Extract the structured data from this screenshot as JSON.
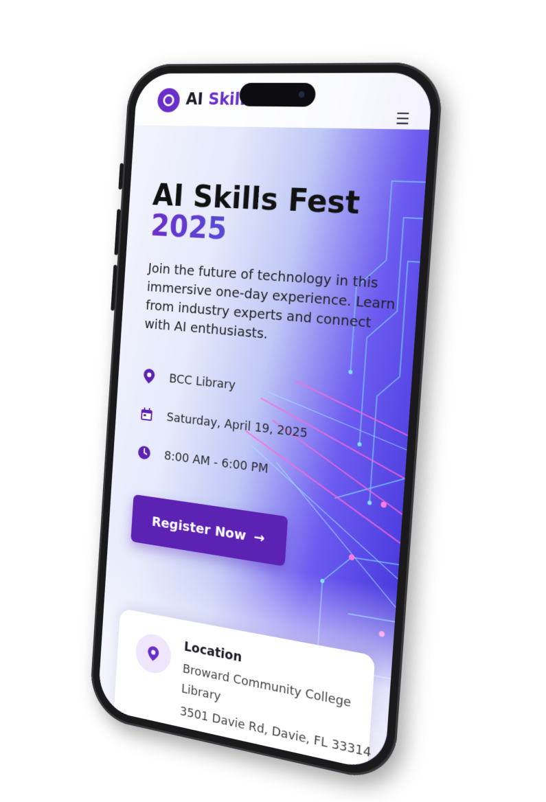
{
  "header": {
    "brand_prefix": "AI",
    "brand_accent": "Skills",
    "logo_icon": "ring-logo-icon",
    "menu_icon": "hamburger-menu-icon"
  },
  "hero": {
    "title": "AI Skills Fest",
    "year": "2025",
    "description": "Join the future of technology in this immersive one-day experience. Learn from industry experts and connect with AI enthusiasts."
  },
  "details": [
    {
      "icon": "map-pin-icon",
      "text": "BCC Library"
    },
    {
      "icon": "calendar-icon",
      "text": "Saturday, April 19, 2025"
    },
    {
      "icon": "clock-icon",
      "text": "8:00 AM - 6:00 PM"
    }
  ],
  "cta": {
    "label": "Register Now",
    "arrow": "→"
  },
  "location_card": {
    "title": "Location",
    "line1": "Broward Community College",
    "line2": "Library",
    "line3": "3501 Davie Rd, Davie, FL 33314"
  },
  "colors": {
    "accent": "#5c22b4",
    "brand_purple": "#6a2ec9",
    "gradient_end": "#2f8cf0"
  }
}
